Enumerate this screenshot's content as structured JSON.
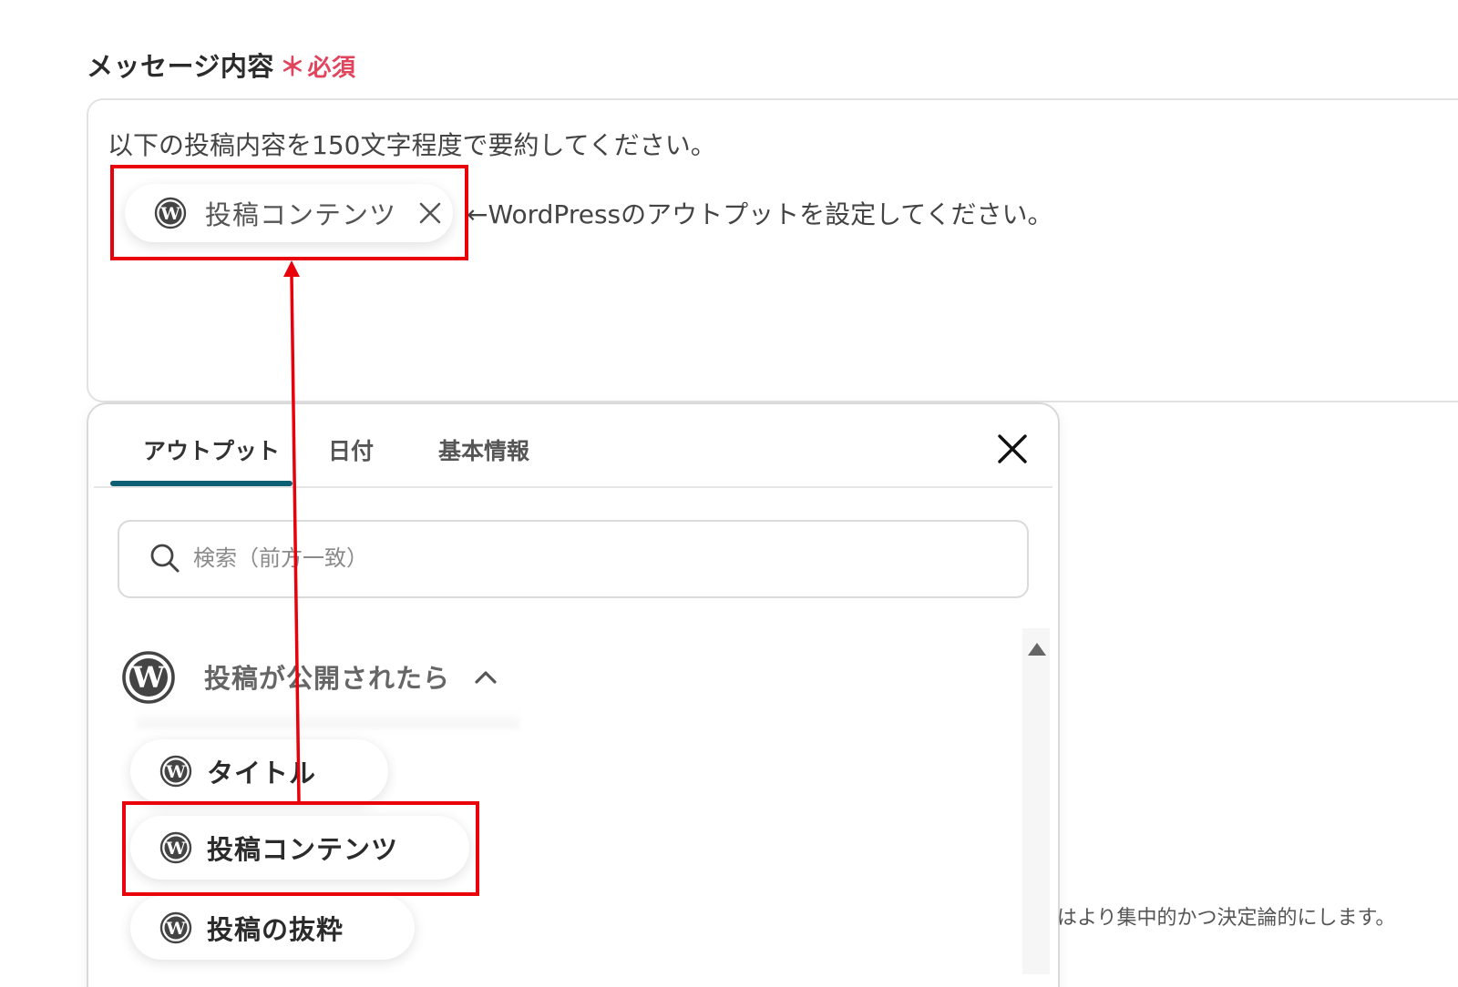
{
  "field": {
    "label": "メッセージ内容",
    "required_star": "＊",
    "required_text": "必須"
  },
  "message": {
    "text": "以下の投稿内容を150文字程度で要約してください。",
    "chip_label": "投稿コンテンツ",
    "hint": "←WordPressのアウトプットを設定してください。"
  },
  "popup": {
    "tabs": [
      "アウトプット",
      "日付",
      "基本情報"
    ],
    "active_tab": "アウトプット",
    "search_placeholder": "検索（前方一致）",
    "group_label": "投稿が公開されたら",
    "items": [
      "タイトル",
      "投稿コンテンツ",
      "投稿の抜粋"
    ]
  },
  "bottom_note": "はより集中的かつ決定論的にします。",
  "colors": {
    "required": "#e0455d",
    "tab_underline": "#0d5f73",
    "highlight_box": "#e8000b"
  },
  "icons": {
    "wordpress": "wordpress-icon",
    "close": "close-icon",
    "search": "search-icon",
    "chevron": "chevron-up-icon"
  }
}
